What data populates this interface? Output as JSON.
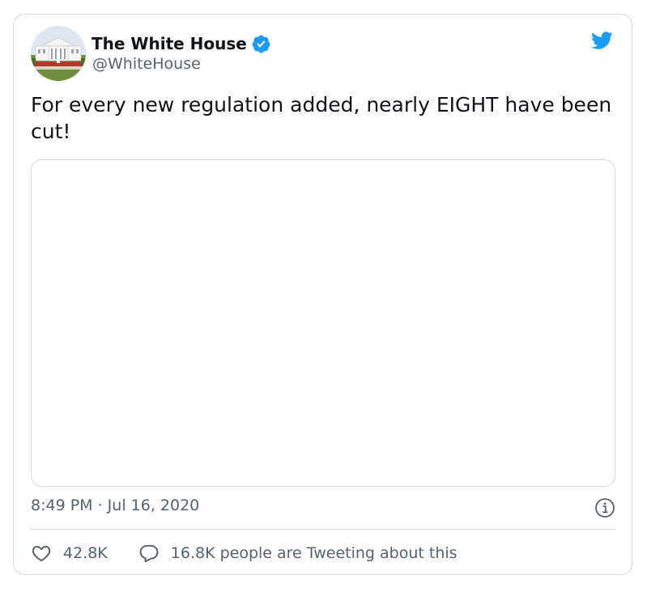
{
  "tweet": {
    "author": {
      "name": "The White House",
      "handle": "@WhiteHouse",
      "verified": true,
      "avatar_icon": "white-house-avatar"
    },
    "text": "For every new regulation added, nearly EIGHT have been cut!",
    "timestamp": "8:49 PM · Jul 16, 2020",
    "likes": "42.8K",
    "conversation": "16.8K people are Tweeting about this"
  },
  "icons": {
    "brand": "twitter-bird-icon",
    "verified": "verified-badge-icon",
    "info": "info-icon",
    "like": "heart-icon",
    "reply": "speech-bubble-icon"
  },
  "colors": {
    "twitter_blue": "#1d9bf0",
    "text_primary": "#0f1419",
    "text_secondary": "#536471",
    "border": "#cfd9de"
  }
}
